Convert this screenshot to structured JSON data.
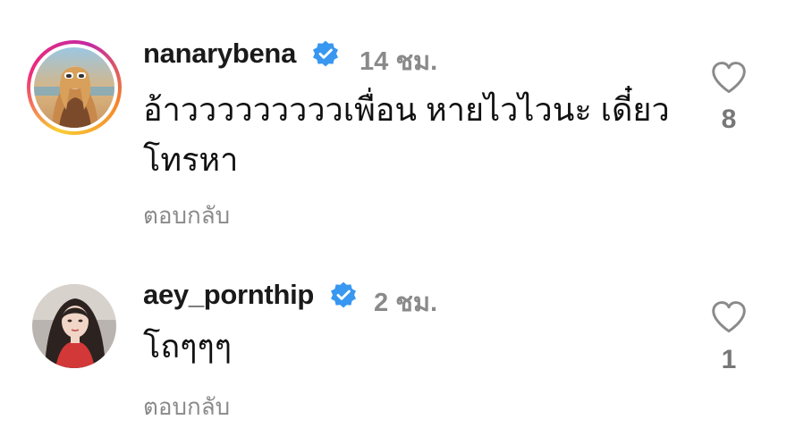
{
  "comments": [
    {
      "username": "nanarybena",
      "verified": true,
      "time": "14 ชม.",
      "text": "อ้าวววววววววเพื่อน หายไวไวนะ เดี๋ยวโทรหา",
      "reply_label": "ตอบกลับ",
      "likes": "8",
      "avatar_icon": "profile-photo",
      "has_story_ring": true
    },
    {
      "username": "aey_pornthip",
      "verified": true,
      "time": "2 ชม.",
      "text": "โถๆๆๆ",
      "reply_label": "ตอบกลับ",
      "likes": "1",
      "avatar_icon": "profile-photo",
      "has_story_ring": false
    }
  ],
  "colors": {
    "verified_blue": "#3897f0",
    "secondary_text": "#8a8a8a"
  }
}
